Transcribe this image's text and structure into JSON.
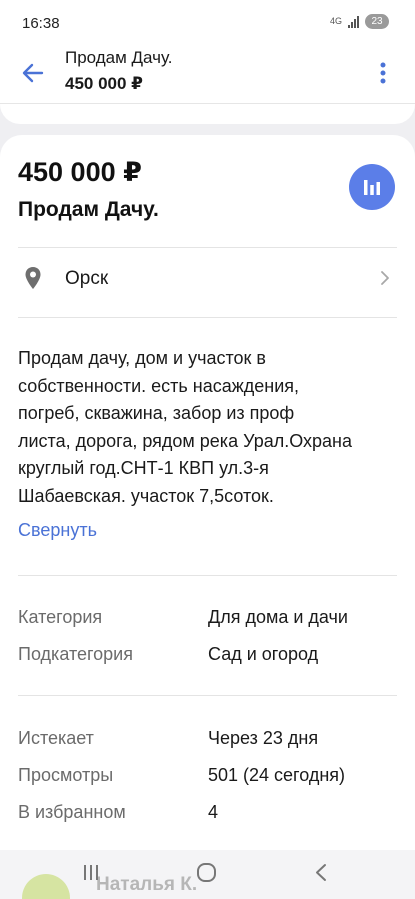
{
  "status_bar": {
    "time": "16:38",
    "network": "4G",
    "battery": "23"
  },
  "app_bar": {
    "title": "Продам Дачу.",
    "price": "450 000 ₽"
  },
  "listing": {
    "price": "450 000 ₽",
    "title": "Продам Дачу.",
    "city": "Орск",
    "description_lines": [
      "Продам дачу, дом и участок в",
      "собственности. есть насаждения,",
      "погреб, скважина, забор из проф",
      "листа, дорога, рядом река Урал.Охрана",
      "круглый год.СНТ-1 КВП ул.3-я",
      "Шабаевская. участок 7,5соток."
    ],
    "collapse_label": "Свернуть"
  },
  "details": {
    "category_key": "Категория",
    "category_val": "Для дома и дачи",
    "subcategory_key": "Подкатегория",
    "subcategory_val": "Сад и огород",
    "expires_key": "Истекает",
    "expires_val": "Через 23 дня",
    "views_key": "Просмотры",
    "views_val": "501 (24 сегодня)",
    "favorites_key": "В избранном",
    "favorites_val": "4"
  },
  "seller": {
    "name": "Наталья К."
  },
  "icons": {
    "back": "arrow-left-icon",
    "menu": "more-vertical-icon",
    "stats": "bar-chart-icon",
    "location": "map-pin-icon",
    "chevron": "chevron-right-icon",
    "nav_recents": "recents-icon",
    "nav_home": "home-icon",
    "nav_back": "nav-back-icon"
  },
  "colors": {
    "accent": "#5b7ee8",
    "link": "#4a72d6",
    "secondary_text": "#6b6b6b"
  }
}
